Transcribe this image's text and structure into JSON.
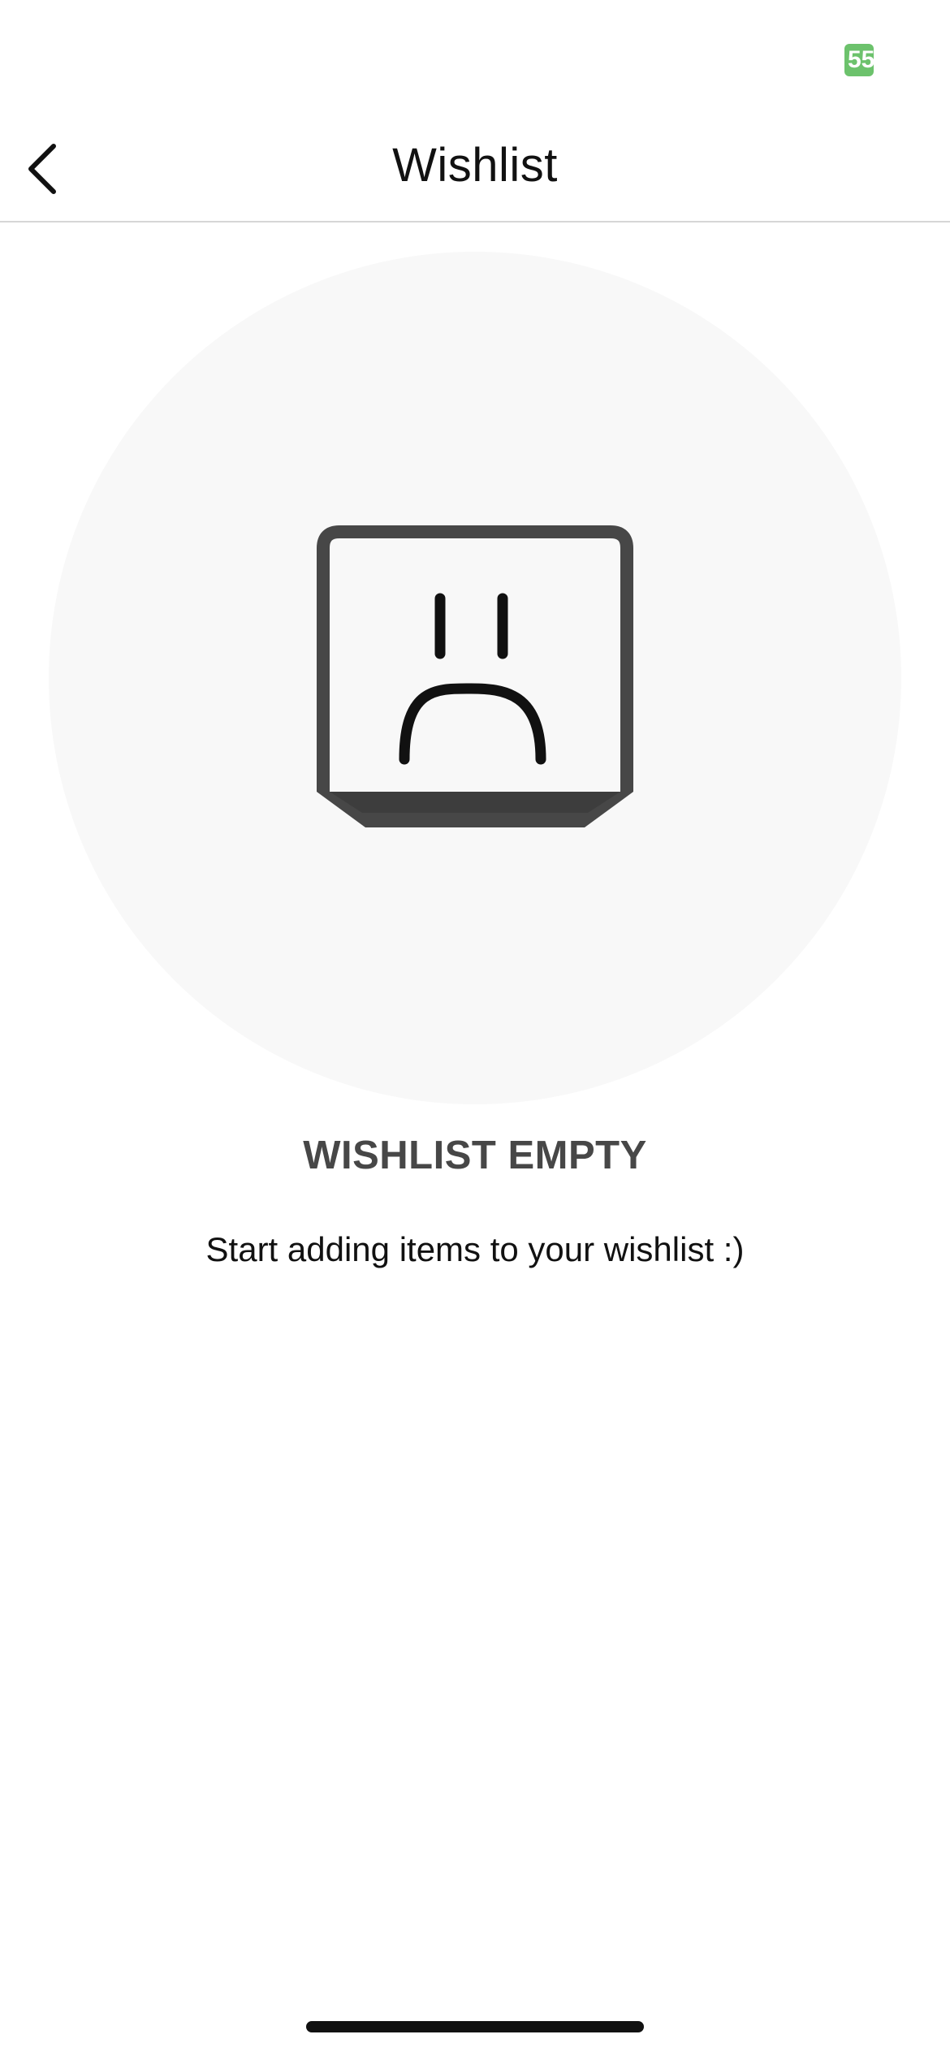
{
  "status_bar": {
    "battery_level": "55",
    "battery_color": "#6cc26c"
  },
  "nav": {
    "back_icon": "chevron-left-icon",
    "title": "Wishlist"
  },
  "empty_state": {
    "illustration_icon": "sad-box-icon",
    "title": "WISHLIST EMPTY",
    "message": "Start adding items to your wishlist :)",
    "circle_color": "#f8f8f8"
  }
}
